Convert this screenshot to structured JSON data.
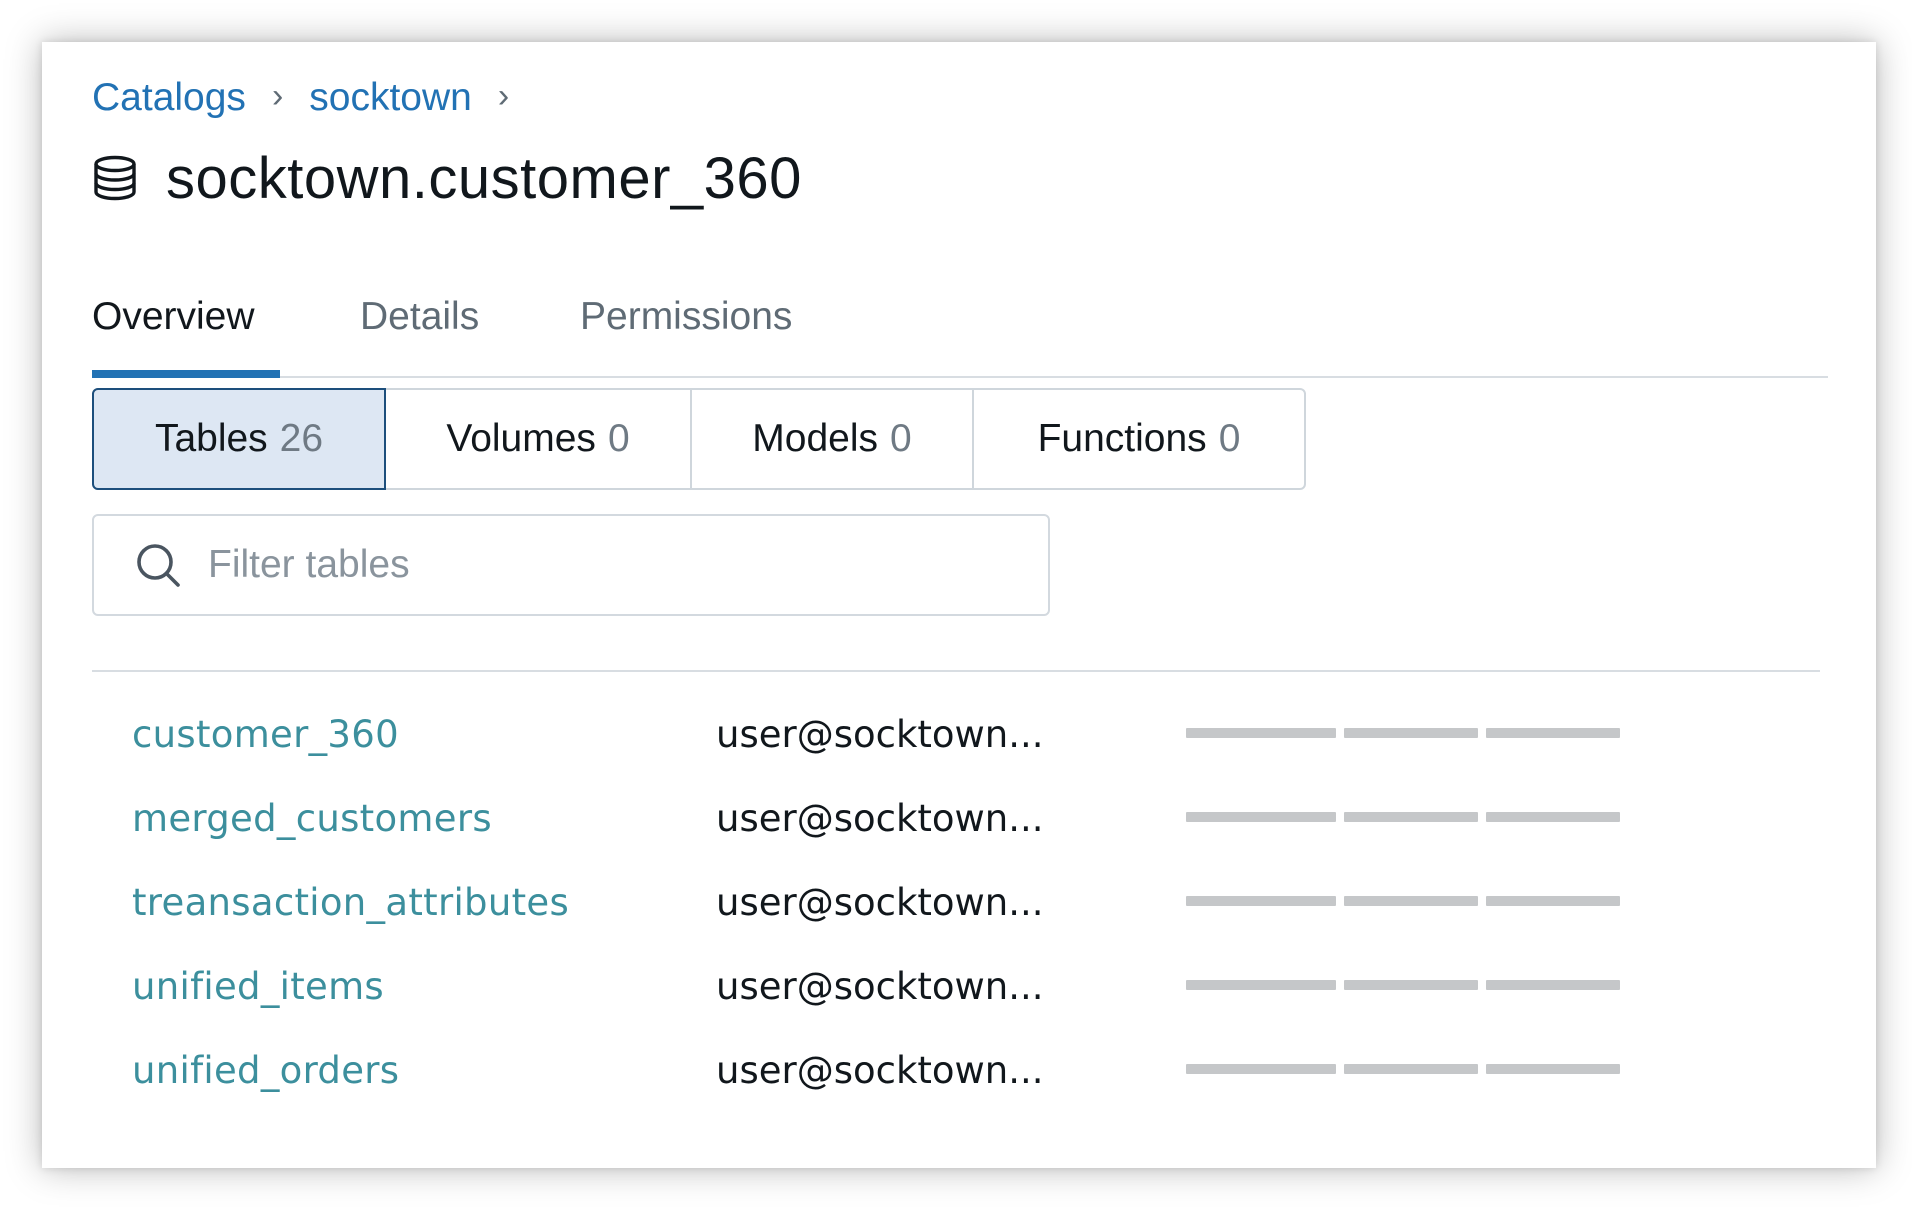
{
  "breadcrumb": {
    "items": [
      "Catalogs",
      "socktown"
    ],
    "separator": "›"
  },
  "page": {
    "title": "socktown.customer_360",
    "icon": "database-icon"
  },
  "tabs": [
    {
      "label": "Overview",
      "active": true
    },
    {
      "label": "Details",
      "active": false
    },
    {
      "label": "Permissions",
      "active": false
    }
  ],
  "segments": [
    {
      "label": "Tables",
      "count": "26",
      "active": true
    },
    {
      "label": "Volumes",
      "count": "0",
      "active": false
    },
    {
      "label": "Models",
      "count": "0",
      "active": false
    },
    {
      "label": "Functions",
      "count": "0",
      "active": false
    }
  ],
  "search": {
    "placeholder": "Filter tables",
    "value": ""
  },
  "tables": [
    {
      "name": "customer_360",
      "owner": "user@socktown..."
    },
    {
      "name": "merged_customers",
      "owner": "user@socktown..."
    },
    {
      "name": "treansaction_attributes",
      "owner": "user@socktown..."
    },
    {
      "name": "unified_items",
      "owner": "user@socktown..."
    },
    {
      "name": "unified_orders",
      "owner": "user@socktown..."
    }
  ],
  "colors": {
    "link": "#2272b4",
    "table_link": "#3c8f9d",
    "active_tab_underline": "#2272b4",
    "active_segment_bg": "#dde7f3",
    "placeholder_bar": "#c5c7c9"
  }
}
